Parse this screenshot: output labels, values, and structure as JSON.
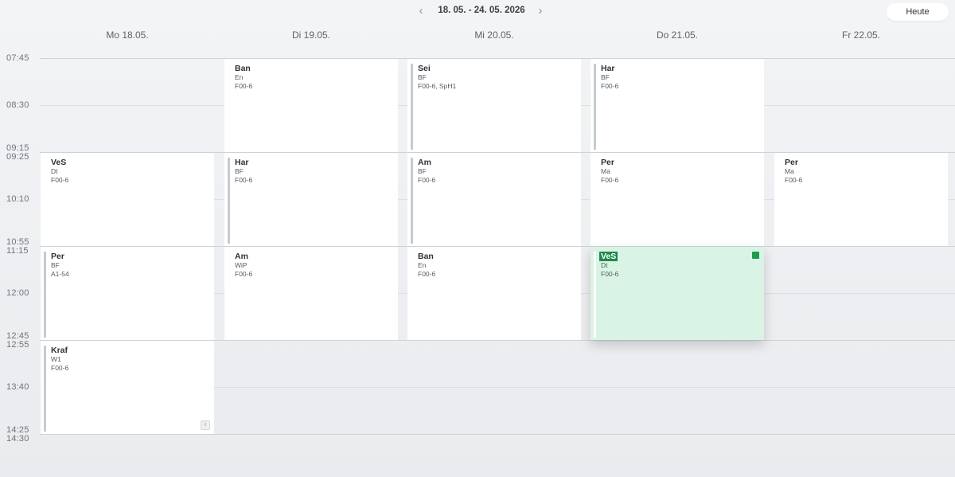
{
  "header": {
    "week_range": "18. 05. - 24. 05. 2026",
    "prev_icon": "chevron-left-icon",
    "next_icon": "chevron-right-icon",
    "today_label": "Heute"
  },
  "days": [
    "Mo 18.05.",
    "Di 19.05.",
    "Mi 20.05.",
    "Do 21.05.",
    "Fr 22.05."
  ],
  "times": [
    "07:45",
    "08:30",
    "09:15",
    "09:25",
    "10:10",
    "10:55",
    "11:15",
    "12:00",
    "12:45",
    "12:55",
    "13:40",
    "14:25",
    "14:30"
  ],
  "lessons": [
    {
      "subject": "Ban",
      "class": "En",
      "room": "F00-6"
    },
    {
      "subject": "Sei",
      "class": "BF",
      "room": "F00-6, SpH1"
    },
    {
      "subject": "Har",
      "class": "BF",
      "room": "F00-6"
    },
    {
      "subject": "VeS",
      "class": "Dt",
      "room": "F00-6"
    },
    {
      "subject": "Har",
      "class": "BF",
      "room": "F00-6"
    },
    {
      "subject": "Am",
      "class": "BF",
      "room": "F00-6"
    },
    {
      "subject": "Per",
      "class": "Ma",
      "room": "F00-6"
    },
    {
      "subject": "Per",
      "class": "Ma",
      "room": "F00-6"
    },
    {
      "subject": "Per",
      "class": "BF",
      "room": "A1-54"
    },
    {
      "subject": "Am",
      "class": "WiP",
      "room": "F00-6"
    },
    {
      "subject": "Ban",
      "class": "En",
      "room": "F00-6"
    },
    {
      "subject": "VeS",
      "class": "Dt",
      "room": "F00-6",
      "selected": true,
      "status_color": "#1f9a4f"
    },
    {
      "subject": "Kraf",
      "class": "W1",
      "room": "F00-6",
      "info_icon": "info-icon"
    }
  ],
  "colors": {
    "selected_bg": "#d9f3e4",
    "selected_accent": "#1e8a4a",
    "bar_gray": "#c6cbd0"
  }
}
